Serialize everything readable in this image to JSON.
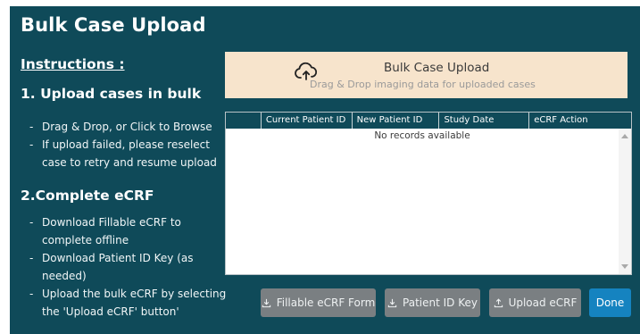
{
  "title": "Bulk Case Upload",
  "instructions_label": "Instructions :",
  "step1": {
    "title": "1. Upload cases in bulk",
    "bullets": [
      "Drag & Drop, or Click to Browse",
      "If upload failed, please reselect case to retry and resume upload"
    ]
  },
  "step2": {
    "title": "2.Complete eCRF",
    "bullets": [
      "Download Fillable eCRF to complete offline",
      "Download Patient ID Key (as needed)",
      "Upload the bulk eCRF by selecting the 'Upload eCRF' button'"
    ]
  },
  "dropzone": {
    "title": "Bulk Case Upload",
    "subtitle": "Drag & Drop imaging data for uploaded cases",
    "icon": "cloud-upload-icon"
  },
  "grid": {
    "columns": [
      "Current Patient ID",
      "New Patient ID",
      "Study Date",
      "eCRF Action"
    ],
    "empty_text": "No records available"
  },
  "buttons": {
    "fillable": "Fillable eCRF Form",
    "patient_key": "Patient ID Key",
    "upload": "Upload eCRF",
    "done": "Done"
  },
  "colors": {
    "panel_bg": "#0f4a59",
    "dropzone_bg": "#f7e4cc",
    "button_gray": "#7a7f82",
    "button_blue": "#1583c0"
  }
}
